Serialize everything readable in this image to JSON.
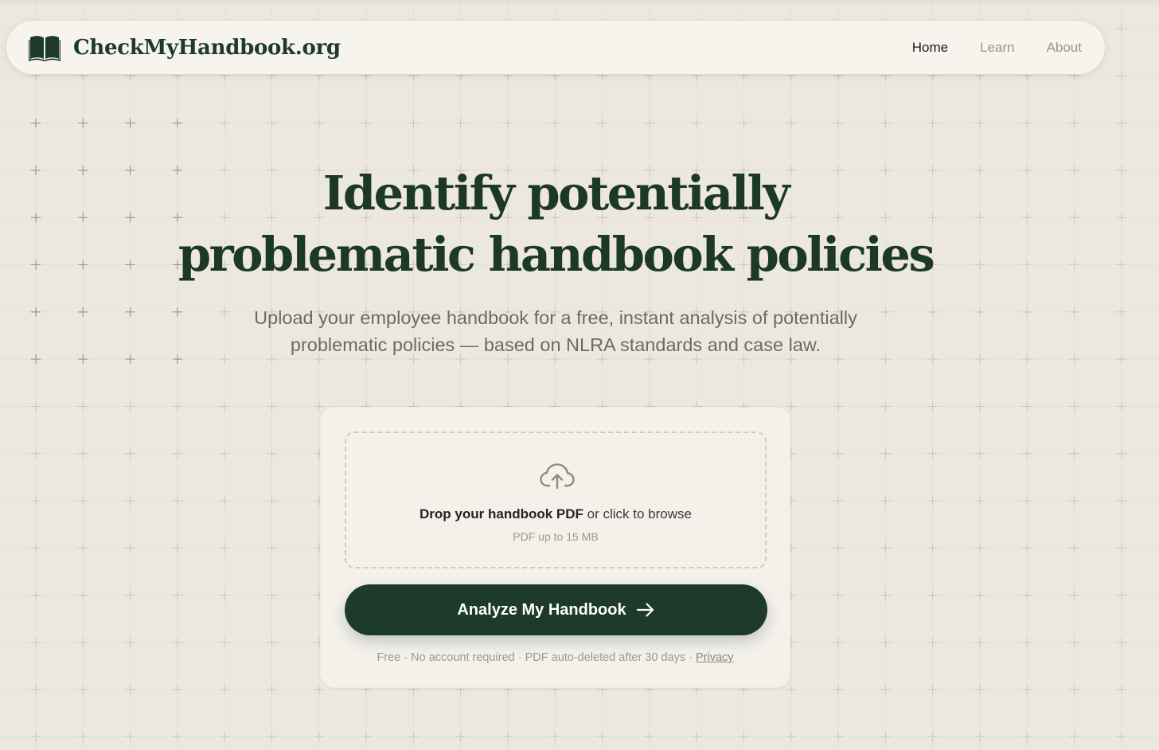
{
  "nav": {
    "brand": "CheckMyHandbook.org",
    "brand_icon": "open-book-icon",
    "links": [
      {
        "label": "Home",
        "active": true
      },
      {
        "label": "Learn",
        "active": false
      },
      {
        "label": "About",
        "active": false
      }
    ]
  },
  "hero": {
    "title_line1": "Identify potentially",
    "title_line2": "problematic handbook policies",
    "subtitle_line1": "Upload your employee handbook for a free, instant analysis of potentially",
    "subtitle_line2": "problematic policies — based on NLRA standards and case law."
  },
  "upload": {
    "icon": "cloud-upload-icon",
    "drop_strong": "Drop your handbook PDF",
    "drop_rest": " or click to browse",
    "limit": "PDF up to 15 MB",
    "button_label": "Analyze My Handbook",
    "button_icon": "arrow-right-icon",
    "footnote": "Free · No account required · PDF auto-deleted after 30 days · ",
    "privacy_label": "Privacy"
  },
  "colors": {
    "background": "#ede8df",
    "brand_green": "#1d3a2a",
    "card": "#f4f1eb",
    "nav": "#f7f4ee",
    "muted_text": "#9b978f"
  }
}
